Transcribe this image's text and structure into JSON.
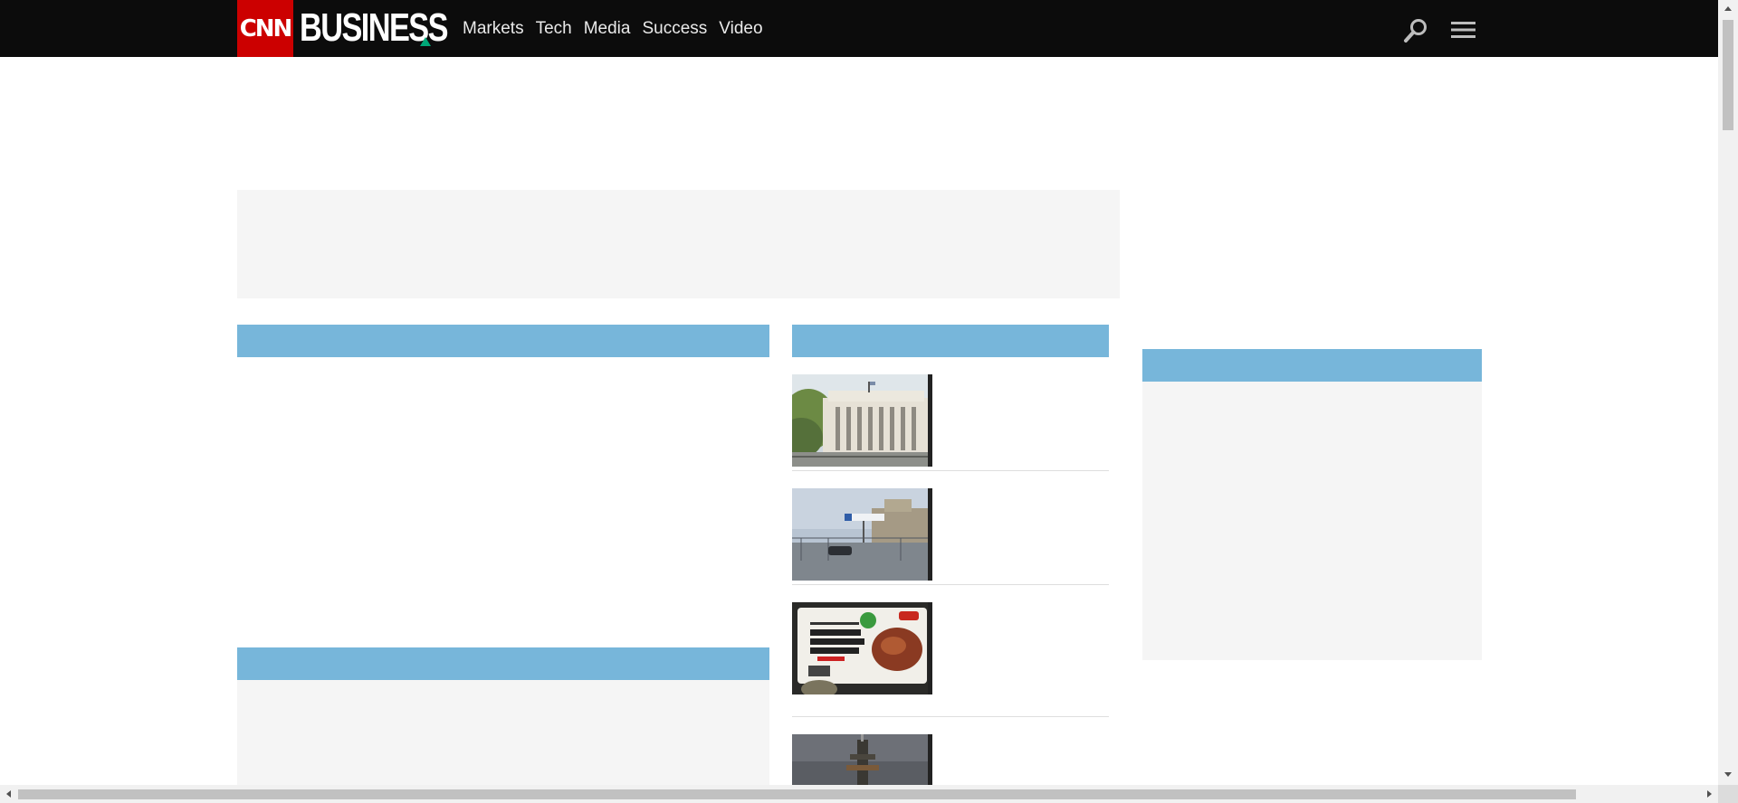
{
  "header": {
    "logo_text": "CNN",
    "section_title": "BUSINESS",
    "nav_items": [
      "Markets",
      "Tech",
      "Media",
      "Success",
      "Video"
    ],
    "icons": [
      "search-icon",
      "menu-icon"
    ]
  },
  "colors": {
    "nav_background": "#0c0c0c",
    "logo_red": "#cc0000",
    "accent_green": "#00a878",
    "zone_header_blue": "#77b6da",
    "placeholder_gray": "#f5f5f5"
  },
  "stories": [
    {
      "image": "federal-reserve-building-photo"
    },
    {
      "image": "plant-entrance-photo"
    },
    {
      "image": "beyond-breakfast-sausage-package-photo"
    },
    {
      "image": "offshore-platform-photo"
    }
  ]
}
